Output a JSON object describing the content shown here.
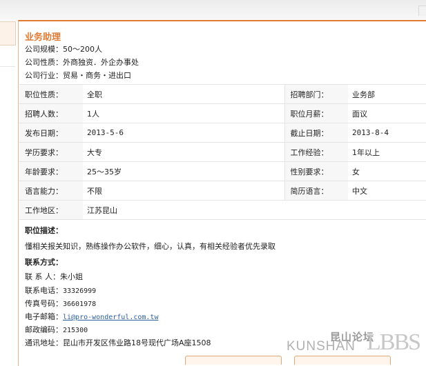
{
  "job": {
    "title": "业务助理",
    "company_size": "公司规模：50～200人",
    "company_nature": "公司性质：外商独资．外企办事处",
    "company_industry": "公司行业：贸易・商务・进出口"
  },
  "details": [
    {
      "l1": "职位性质：",
      "v1": "全职",
      "l2": "招聘部门：",
      "v2": "业务部"
    },
    {
      "l1": "招聘人数：",
      "v1": "1人",
      "l2": "职位月薪：",
      "v2": "面议"
    },
    {
      "l1": "发布日期：",
      "v1": "2013-5-6",
      "l2": "截止日期：",
      "v2": "2013-8-4"
    },
    {
      "l1": "学历要求：",
      "v1": "大专",
      "l2": "工作经验：",
      "v2": "1年以上"
    },
    {
      "l1": "年龄要求：",
      "v1": "25～35岁",
      "l2": "性别要求：",
      "v2": "女"
    },
    {
      "l1": "语言能力：",
      "v1": "不限",
      "l2": "简历语言：",
      "v2": "中文"
    }
  ],
  "location": {
    "label": "工作地区：",
    "value": "江苏昆山"
  },
  "description": {
    "heading": "职位描述：",
    "text": "懂相关报关知识，熟练操作办公软件，细心，认真，有相关经验者优先录取"
  },
  "contact": {
    "heading": "联系方式：",
    "person_label": "联 系 人：",
    "person": "朱小姐",
    "phone_label": "联系电话：",
    "phone": "33326999",
    "fax_label": "传真号码：",
    "fax": "36601978",
    "email_label": "电子邮箱：",
    "email": "li@pro-wonderful.com.tw",
    "zip_label": "邮政编码：",
    "zip": "215300",
    "address_label": "通讯地址：",
    "address": "昆山市开发区伟业路18号现代广场A座1508"
  },
  "watermark": {
    "cn": "昆山论坛",
    "en": "KUNSHAN",
    "bbs": "LBBS"
  }
}
